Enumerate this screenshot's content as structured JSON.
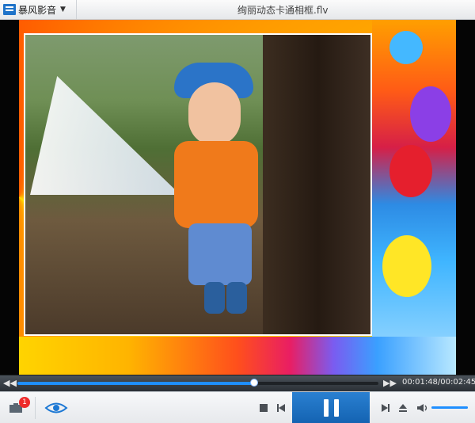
{
  "window": {
    "app_name": "暴风影音",
    "file_title": "绚丽动态卡通相框.flv"
  },
  "playback": {
    "current_time": "00:01:48",
    "total_time": "00:02:45",
    "time_display": "00:01:48/00:02:45",
    "progress": 0.655,
    "volume": 1.0
  },
  "controls": {
    "toolbox_badge": "1"
  },
  "colors": {
    "accent": "#1f8fff",
    "play_button": "#1869b8",
    "badge": "#ee2a2a"
  },
  "icons": {
    "menu": "app-logo-icon",
    "toolbox": "toolbox-icon",
    "eye": "eye-icon",
    "stop": "stop-icon",
    "step_back": "step-back-icon",
    "pause": "pause-icon",
    "step_forward": "step-forward-icon",
    "eject": "eject-icon",
    "volume": "volume-icon"
  }
}
